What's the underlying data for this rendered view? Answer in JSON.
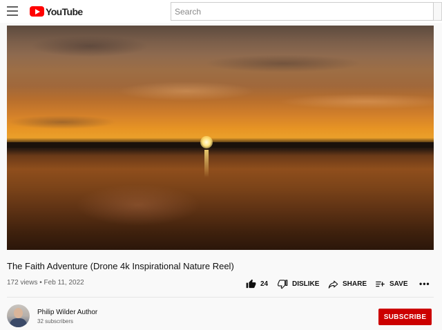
{
  "header": {
    "logo_text": "YouTube",
    "search": {
      "placeholder": "Search",
      "value": ""
    }
  },
  "video": {
    "title": "The Faith Adventure (Drone 4k Inspirational Nature Reel)",
    "meta": "172 views • Feb 11, 2022"
  },
  "actions": {
    "like_count": "24",
    "dislike_label": "DISLIKE",
    "share_label": "SHARE",
    "save_label": "SAVE",
    "more_label": "•••"
  },
  "channel": {
    "name": "Philip Wilder Author",
    "subscribers": "32 subscribers",
    "subscribe_label": "SUBSCRIBE"
  },
  "colors": {
    "brand_red": "#ff0000",
    "subscribe_red": "#cc0000",
    "secondary_text": "#606060"
  }
}
